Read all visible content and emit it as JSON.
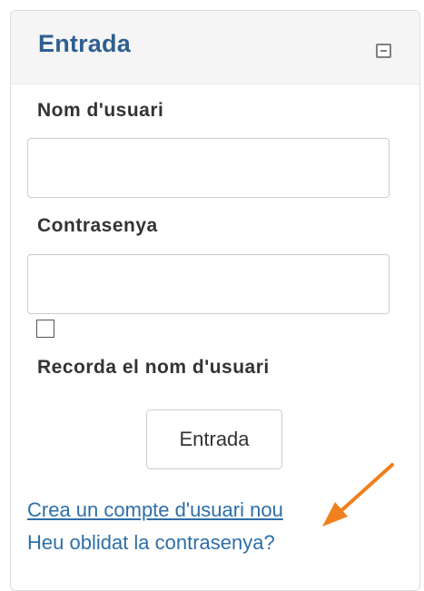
{
  "block": {
    "title": "Entrada"
  },
  "login": {
    "username_label": "Nom d'usuari",
    "username_value": "",
    "password_label": "Contrasenya",
    "password_value": "",
    "remember_label": "Recorda el nom d'usuari",
    "remember_checked": false,
    "submit_label": "Entrada",
    "create_account_link": "Crea un compte d'usuari nou",
    "forgot_password_link": "Heu oblidat la contrasenya?"
  },
  "icons": {
    "collapse": "minus-square-icon",
    "annotation": "arrow-icon"
  },
  "colors": {
    "title": "#2f5f8f",
    "link": "#2f6fa8",
    "arrow": "#f07f1d",
    "header_bg": "#f5f5f5"
  }
}
